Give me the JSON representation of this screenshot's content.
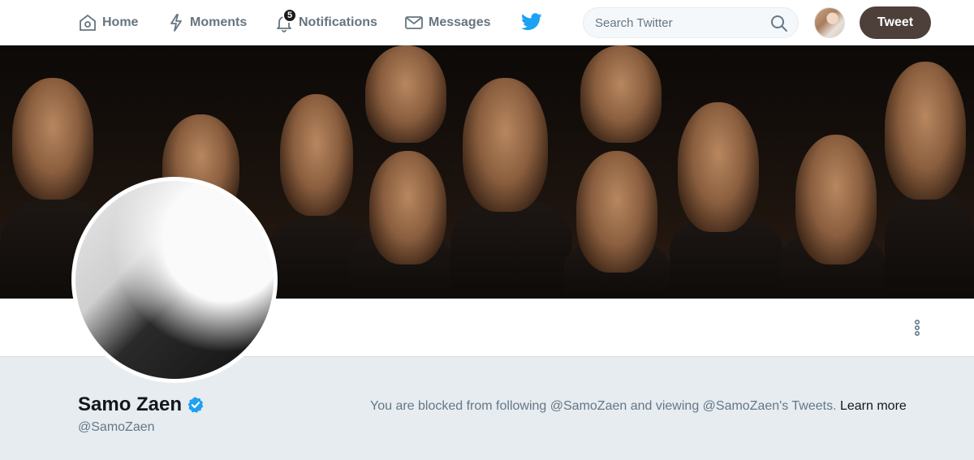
{
  "nav": {
    "home": "Home",
    "moments": "Moments",
    "notifications": "Notifications",
    "notifications_count": "5",
    "messages": "Messages"
  },
  "search": {
    "placeholder": "Search Twitter"
  },
  "tweet_button": "Tweet",
  "profile": {
    "name": "Samo Zaen",
    "handle": "@SamoZaen",
    "verified": true
  },
  "blocked_notice": {
    "text": "You are blocked from following @SamoZaen and viewing @SamoZaen's Tweets.",
    "link": "Learn more"
  },
  "colors": {
    "twitter_blue": "#1da1f2",
    "tweet_button_bg": "#4d3f3a",
    "page_bg": "#e6ecf0"
  }
}
